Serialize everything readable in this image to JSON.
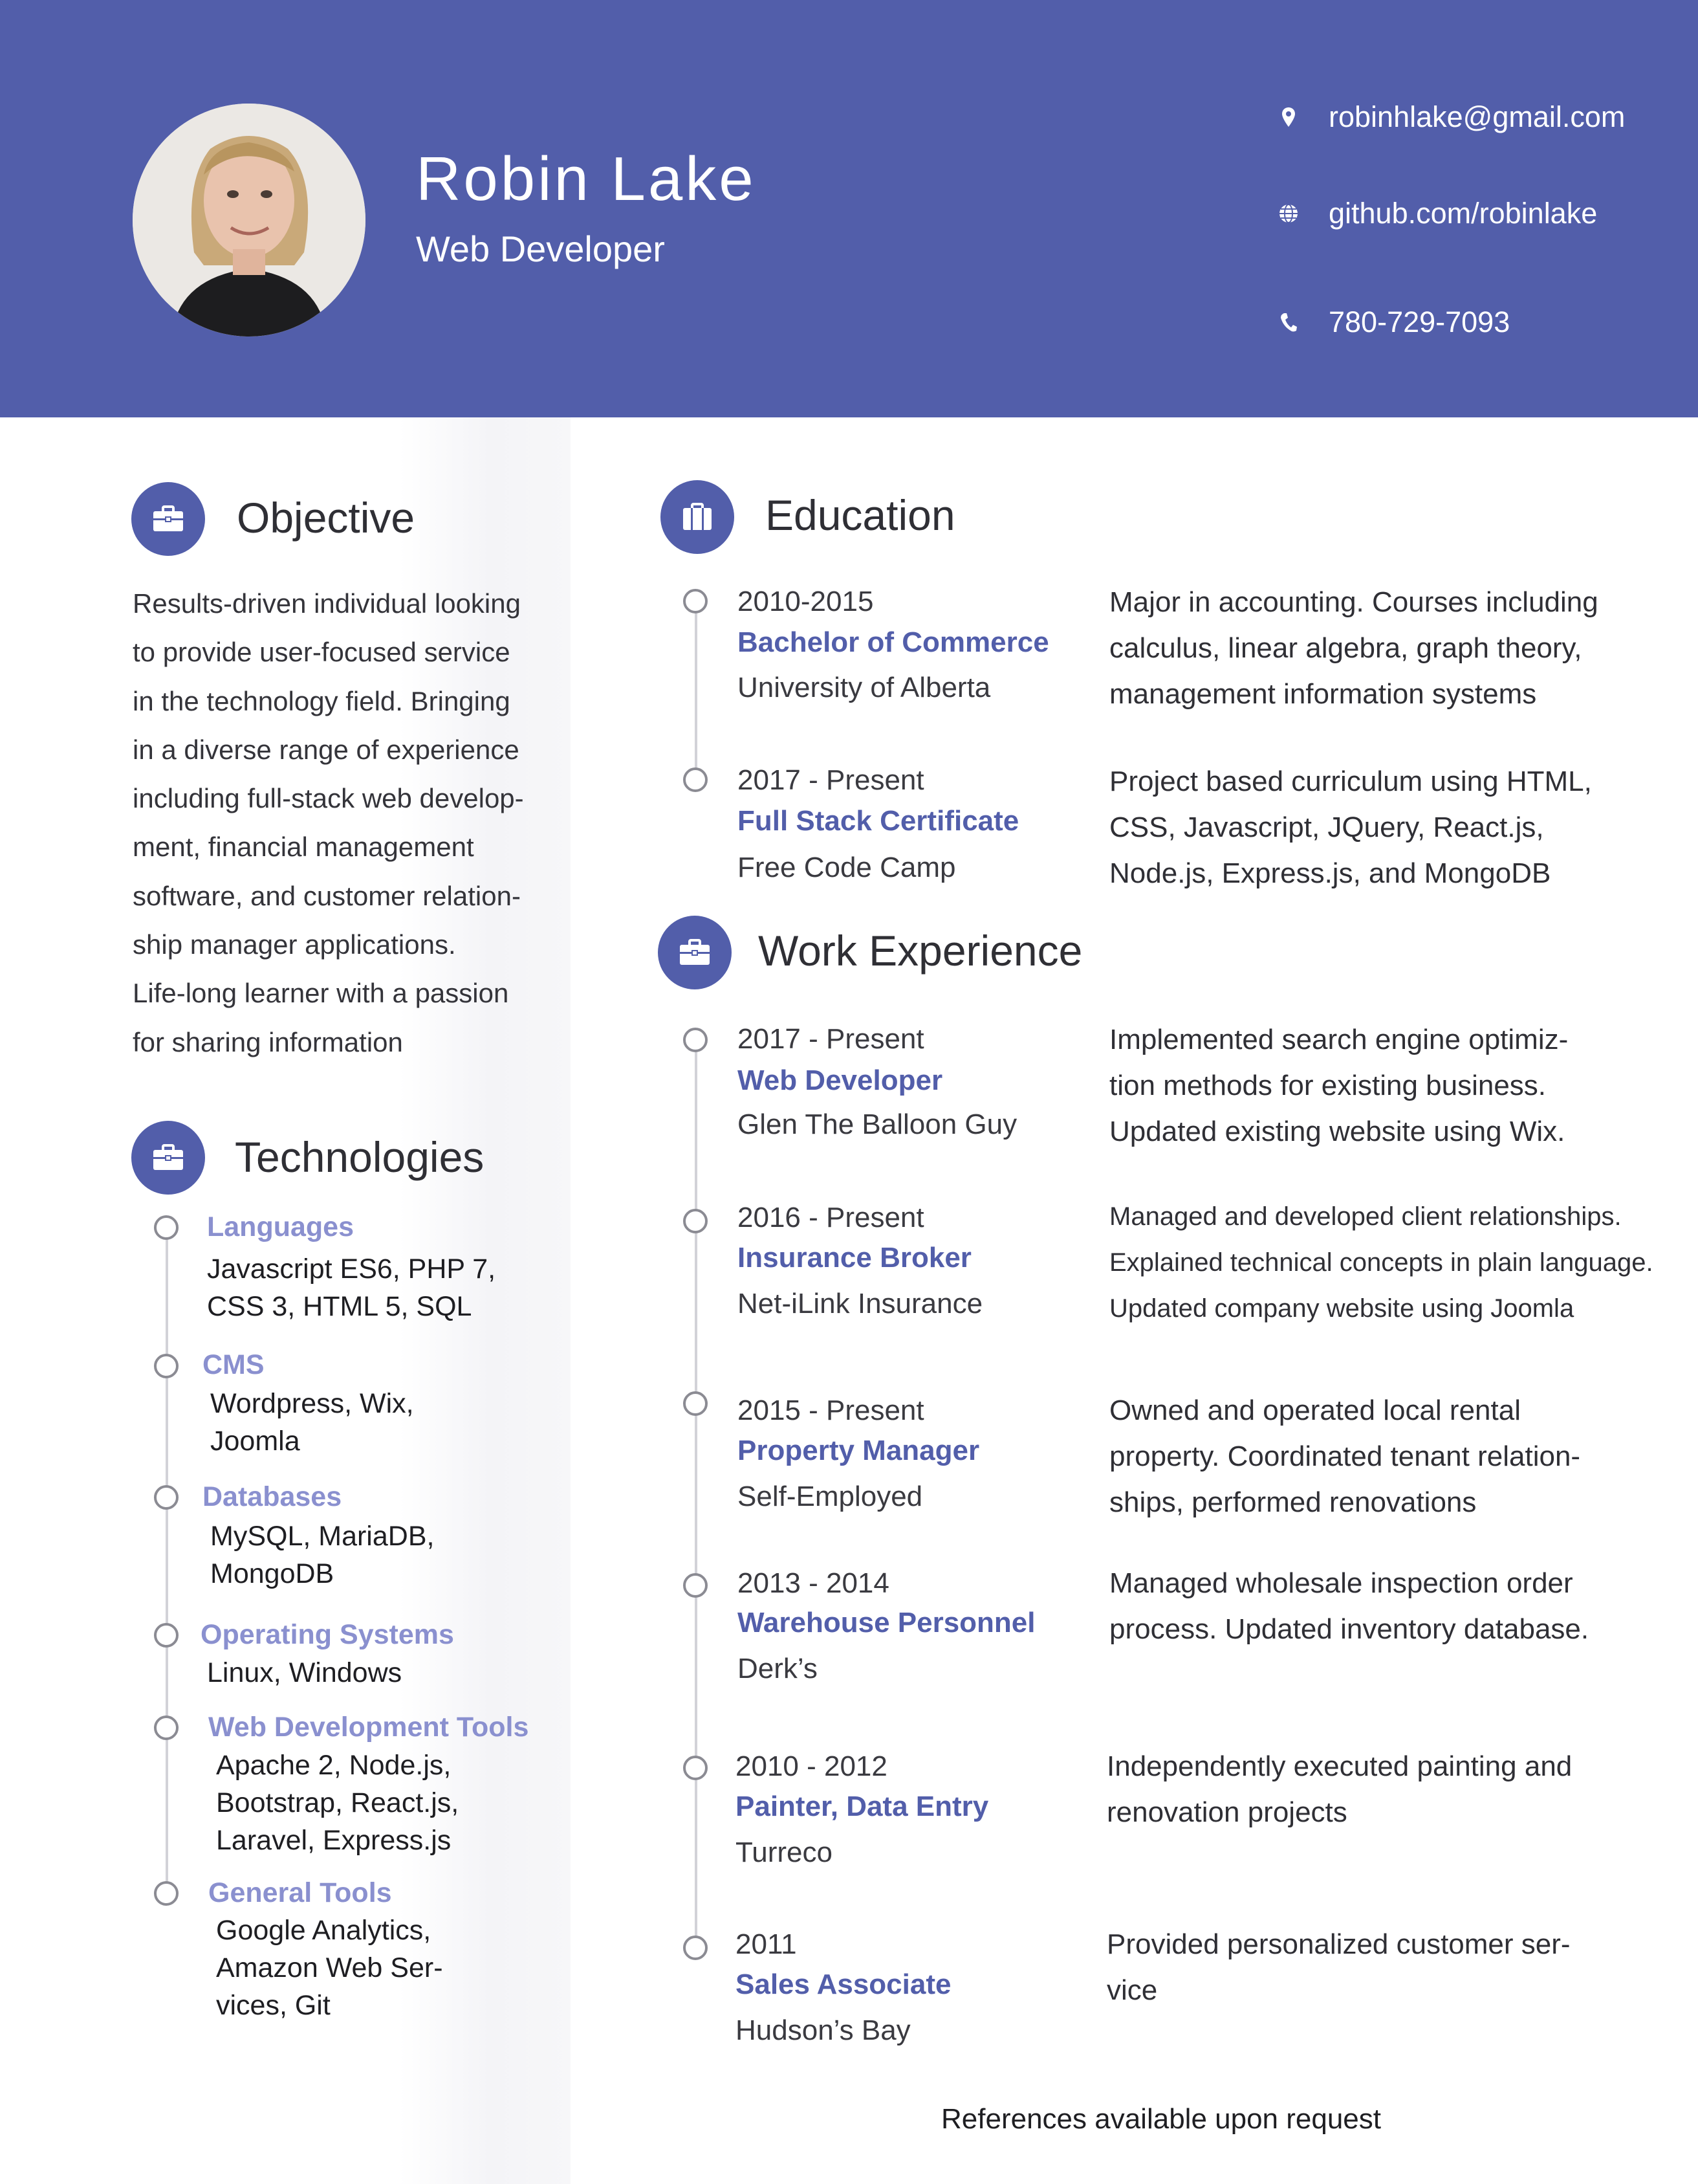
{
  "header": {
    "name": "Robin Lake",
    "role": "Web Developer",
    "contacts": [
      {
        "icon": "map-pin-icon",
        "text": "robinhlake@gmail.com"
      },
      {
        "icon": "globe-icon",
        "text": "github.com/robinlake"
      },
      {
        "icon": "phone-icon",
        "text": "780-729-7093"
      }
    ],
    "accent_color": "#525eaa"
  },
  "objective": {
    "heading": "Objective",
    "icon": "briefcase-icon",
    "lines": [
      "Results-driven individual looking",
      "to provide user-focused service",
      "in the technology field. Bringing",
      "in a diverse range of experience",
      "including full-stack web develop-",
      "ment, financial management",
      "software, and customer relation-",
      "ship manager applications.",
      "Life-long learner with a passion",
      "for sharing information"
    ]
  },
  "technologies": {
    "heading": "Technologies",
    "icon": "briefcase-icon",
    "items": [
      {
        "category": "Languages",
        "lines": [
          "Javascript ES6, PHP 7,",
          "CSS 3, HTML 5, SQL"
        ]
      },
      {
        "category": "CMS",
        "lines": [
          "Wordpress, Wix,",
          "Joomla"
        ]
      },
      {
        "category": "Databases",
        "lines": [
          "MySQL, MariaDB,",
          "MongoDB"
        ]
      },
      {
        "category": "Operating Systems",
        "lines": [
          "Linux, Windows"
        ]
      },
      {
        "category": "Web Development Tools",
        "lines": [
          "Apache 2, Node.js,",
          "Bootstrap, React.js,",
          "Laravel, Express.js"
        ]
      },
      {
        "category": "General Tools",
        "lines": [
          "Google Analytics,",
          "Amazon Web Ser-",
          "vices, Git"
        ]
      }
    ]
  },
  "education": {
    "heading": "Education",
    "icon": "building-icon",
    "items": [
      {
        "date": "2010-2015",
        "title": "Bachelor of Commerce",
        "org": "University of Alberta",
        "desc": [
          "Major in accounting.  Courses including",
          "calculus, linear algebra, graph theory,",
          "management information systems"
        ]
      },
      {
        "date": "2017 - Present",
        "title": "Full Stack Certificate",
        "org": "Free Code Camp",
        "desc": [
          "Project based curriculum using HTML,",
          "CSS, Javascript, JQuery, React.js,",
          "Node.js, Express.js, and MongoDB"
        ]
      }
    ]
  },
  "work": {
    "heading": "Work Experience",
    "icon": "briefcase-icon",
    "items": [
      {
        "date": "2017 - Present",
        "title": "Web Developer",
        "org": "Glen The Balloon Guy",
        "desc": [
          "Implemented search engine optimiz-",
          "tion methods for existing business.",
          "Updated existing website using Wix."
        ]
      },
      {
        "date": "2016 - Present",
        "title": "Insurance Broker",
        "org": "Net-iLink Insurance",
        "desc": [
          "Managed and developed client relationships.",
          "Explained technical concepts in plain language.",
          "Updated company website using Joomla"
        ]
      },
      {
        "date": "2015 - Present",
        "title": "Property Manager",
        "org": "Self-Employed",
        "desc": [
          "Owned and operated local rental",
          "property. Coordinated tenant relation-",
          "ships, performed renovations"
        ]
      },
      {
        "date": "2013 - 2014",
        "title": "Warehouse Personnel",
        "org": "Derk’s",
        "desc": [
          "Managed wholesale inspection order",
          "process. Updated inventory database."
        ]
      },
      {
        "date": "2010 - 2012",
        "title": "Painter, Data Entry",
        "org": "Turreco",
        "desc": [
          "Independently executed painting and",
          "renovation projects"
        ]
      },
      {
        "date": "2011",
        "title": "Sales Associate",
        "org": "Hudson’s Bay",
        "desc": [
          "Provided personalized customer ser-",
          "vice"
        ]
      }
    ]
  },
  "footer": {
    "references": "References available upon request"
  }
}
